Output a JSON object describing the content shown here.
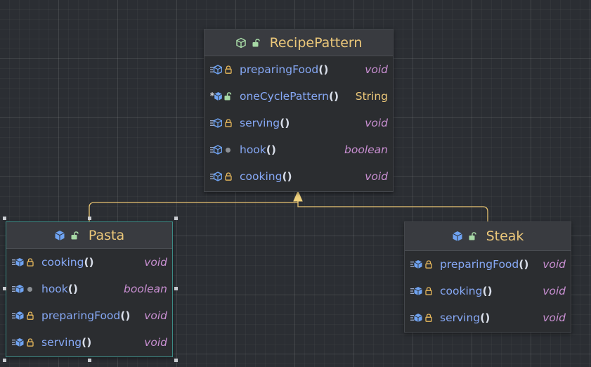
{
  "colors": {
    "canvas": "#2b2e33",
    "node_bg": "#2b2d30",
    "header_bg": "#393b40",
    "class_name": "#ecc87a",
    "method": "#86a8f5",
    "keyword_type": "#c98fd2",
    "class_type": "#ecc87a",
    "edge": "#e6c270",
    "selection": "#3d8b86"
  },
  "classes": {
    "recipe": {
      "name": "RecipePattern",
      "methods": [
        {
          "name": "preparingFood",
          "parens": "()",
          "type": "void",
          "icon": "method-icon",
          "access": "lock-icon"
        },
        {
          "name": "oneCyclePattern",
          "parens": "()",
          "type": "String",
          "icon": "static-method-icon",
          "access": "unlock-icon"
        },
        {
          "name": "serving",
          "parens": "()",
          "type": "void",
          "icon": "method-icon",
          "access": "lock-icon"
        },
        {
          "name": "hook",
          "parens": "()",
          "type": "boolean",
          "icon": "method-icon",
          "access": "package-dot-icon"
        },
        {
          "name": "cooking",
          "parens": "()",
          "type": "void",
          "icon": "method-icon",
          "access": "lock-icon"
        }
      ]
    },
    "pasta": {
      "name": "Pasta",
      "methods": [
        {
          "name": "cooking",
          "parens": "()",
          "type": "void"
        },
        {
          "name": "hook",
          "parens": "()",
          "type": "boolean"
        },
        {
          "name": "preparingFood",
          "parens": "()",
          "type": "void"
        },
        {
          "name": "serving",
          "parens": "()",
          "type": "void"
        }
      ]
    },
    "steak": {
      "name": "Steak",
      "methods": [
        {
          "name": "preparingFood",
          "parens": "()",
          "type": "void"
        },
        {
          "name": "cooking",
          "parens": "()",
          "type": "void"
        },
        {
          "name": "serving",
          "parens": "()",
          "type": "void"
        }
      ]
    }
  },
  "edges": [
    {
      "from": "Pasta",
      "to": "RecipePattern",
      "kind": "inheritance"
    },
    {
      "from": "Steak",
      "to": "RecipePattern",
      "kind": "inheritance"
    }
  ]
}
